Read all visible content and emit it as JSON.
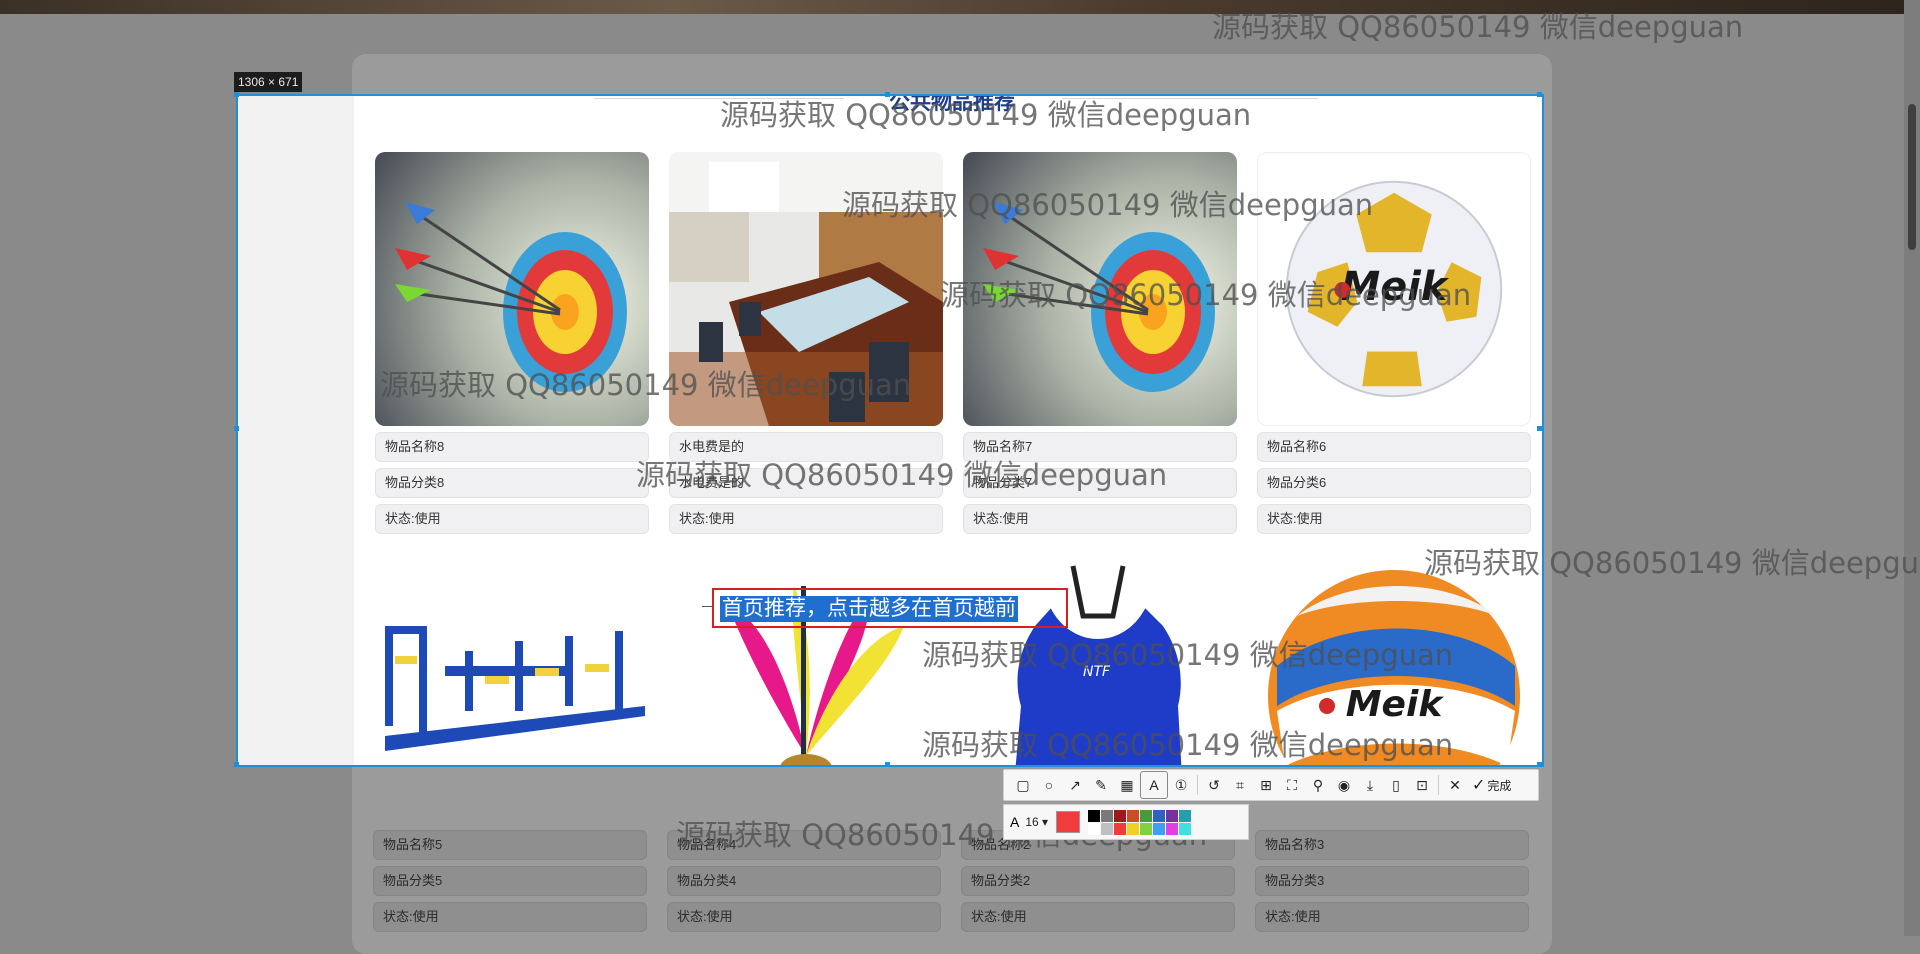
{
  "capture": {
    "size_label": "1306 × 671"
  },
  "section": {
    "title": "公共物品推荐"
  },
  "items_row1": [
    {
      "name": "物品名称8",
      "category": "物品分类8",
      "status": "状态:使用"
    },
    {
      "name": "水电费是的",
      "category": "水电费是的",
      "status": "状态:使用"
    },
    {
      "name": "物品名称7",
      "category": "物品分类7",
      "status": "状态:使用"
    },
    {
      "name": "物品名称6",
      "category": "物品分类6",
      "status": "状态:使用"
    }
  ],
  "items_row2": [
    {
      "name": "物品名称5",
      "category": "物品分类5",
      "status": "状态:使用"
    },
    {
      "name": "物品名称4",
      "category": "物品分类4",
      "status": "状态:使用"
    },
    {
      "name": "物品名称2",
      "category": "物品分类2",
      "status": "状态:使用"
    },
    {
      "name": "物品名称3",
      "category": "物品分类3",
      "status": "状态:使用"
    }
  ],
  "annotation": {
    "text": "首页推荐，点击越多在首页越前"
  },
  "watermark": "源码获取 QQ86050149 微信deepguan",
  "toolbar": {
    "done_label": "完成",
    "font_size": "16",
    "current_color": "#f23c3c",
    "palette": [
      "#000000",
      "#7a7a7a",
      "#a01818",
      "#c85020",
      "#4a9a3a",
      "#3060c0",
      "#7a30a0",
      "#20a0b0",
      "#ffffff",
      "#c0c0c0",
      "#f23c3c",
      "#f0d020",
      "#80d040",
      "#40a0f0",
      "#e040e0",
      "#40e0e0"
    ]
  }
}
